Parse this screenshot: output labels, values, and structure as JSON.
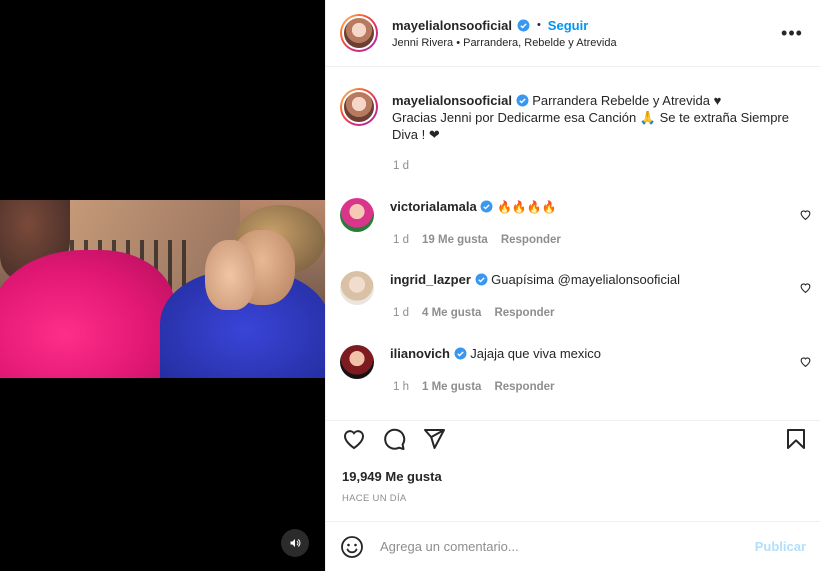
{
  "header": {
    "username": "mayelialonsooficial",
    "dot": "•",
    "follow_label": "Seguir",
    "subtitle": "Jenni Rivera • Parrandera, Rebelde y Atrevida",
    "more": "•••"
  },
  "caption": {
    "username": "mayelialonsooficial",
    "text_line1": "Parrandera Rebelde y Atrevida ♥",
    "text_line2": "Gracias Jenni por Dedicarme esa Canción 🙏 Se te extraña Siempre",
    "text_line3": "Diva ! ❤",
    "time": "1 d"
  },
  "comments": [
    {
      "username": "victorialamala",
      "text": "🔥🔥🔥🔥",
      "time": "1 d",
      "likes": "19 Me gusta",
      "reply": "Responder"
    },
    {
      "username": "ingrid_lazper",
      "text": "Guapísima @mayelialonsooficial",
      "time": "1 d",
      "likes": "4 Me gusta",
      "reply": "Responder"
    },
    {
      "username": "ilianovich",
      "text": "Jajaja que viva mexico",
      "time": "1 h",
      "likes": "1 Me gusta",
      "reply": "Responder"
    }
  ],
  "stats": {
    "likes": "19,949 Me gusta",
    "ago": "HACE UN DÍA"
  },
  "add_comment": {
    "placeholder": "Agrega un comentario...",
    "publish_label": "Publicar"
  },
  "colors": {
    "accent": "#0095f6",
    "verified": "#3897f0",
    "publish_disabled": "#b2dffc"
  },
  "icons": [
    "volume-icon",
    "verified-icon",
    "more-icon",
    "heart-icon",
    "comment-icon",
    "share-icon",
    "bookmark-icon",
    "emoji-icon"
  ]
}
